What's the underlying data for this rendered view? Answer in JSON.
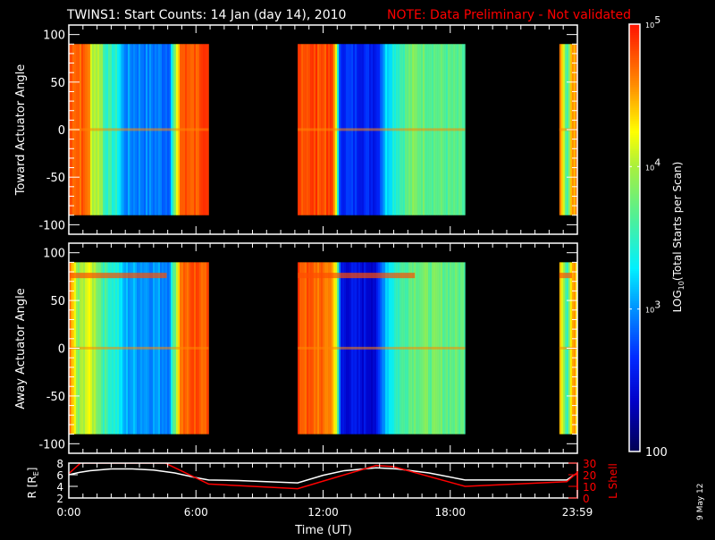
{
  "chart_data": {
    "type": "heatmap",
    "title": "TWINS1: Start Counts: 14 Jan (day  14), 2010",
    "note": "NOTE: Data Preliminary - Not validated",
    "date_stamp": "9 May 12",
    "colors": {
      "background": "#000000",
      "axis": "#ffffff",
      "note": "#ff0000",
      "lshell": "#ff0000",
      "radius": "#ffffff"
    },
    "xlabel": "Time (UT)",
    "x_ticks": [
      "0:00",
      "6:00",
      "12:00",
      "18:00",
      "23:59"
    ],
    "x_tick_hours": [
      0,
      6,
      12,
      18,
      24
    ],
    "xlim_hours": [
      0,
      24
    ],
    "colorbar": {
      "label": "LOG10(Total Starts per Scan)",
      "label_main": "LOG",
      "label_sub": "10",
      "label_rest": "(Total Starts per Scan)",
      "ticks": [
        "100",
        "10",
        "10",
        "10"
      ],
      "tick_exponents": [
        "",
        "3",
        "4",
        "5"
      ],
      "tick_log_values": [
        2,
        3,
        4,
        5
      ],
      "range_log": [
        2,
        5
      ]
    },
    "panels": [
      {
        "ylabel": "Toward Actuator Angle",
        "ylim": [
          -110,
          110
        ],
        "y_ticks": [
          "100",
          "50",
          "0",
          "-50",
          "-100"
        ],
        "y_tick_values": [
          100,
          50,
          0,
          -50,
          -100
        ],
        "angle_range": [
          -90,
          90
        ],
        "time_blocks_hours": [
          [
            0,
            6.6
          ],
          [
            10.8,
            18.7
          ],
          [
            23.15,
            24
          ]
        ],
        "log_counts_profile": [
          [
            0,
            4.8
          ],
          [
            0.9,
            4.7
          ],
          [
            1.0,
            4.1
          ],
          [
            1.5,
            4.0
          ],
          [
            1.6,
            3.6
          ],
          [
            2.3,
            3.4
          ],
          [
            2.5,
            3.0
          ],
          [
            4.7,
            2.9
          ],
          [
            4.9,
            3.6
          ],
          [
            5.1,
            4.2
          ],
          [
            5.2,
            4.75
          ],
          [
            6.6,
            4.8
          ],
          [
            10.8,
            4.85
          ],
          [
            12.4,
            4.8
          ],
          [
            12.6,
            4.2
          ],
          [
            12.7,
            2.7
          ],
          [
            14.5,
            2.6
          ],
          [
            14.9,
            3.2
          ],
          [
            15.4,
            3.5
          ],
          [
            16.2,
            3.8
          ],
          [
            18.7,
            3.6
          ],
          [
            23.15,
            4.6
          ],
          [
            23.5,
            3.4
          ],
          [
            23.7,
            4.6
          ],
          [
            24,
            4.5
          ]
        ],
        "zero_band_log": 4.6
      },
      {
        "ylabel": "Away Actuator Angle",
        "ylim": [
          -110,
          110
        ],
        "y_ticks": [
          "100",
          "50",
          "0",
          "-50",
          "-100"
        ],
        "y_tick_values": [
          100,
          50,
          0,
          -50,
          -100
        ],
        "angle_range": [
          -90,
          90
        ],
        "time_blocks_hours": [
          [
            0,
            6.6
          ],
          [
            10.8,
            18.7
          ],
          [
            23.15,
            24
          ]
        ],
        "log_counts_profile": [
          [
            0,
            4.7
          ],
          [
            0.4,
            3.8
          ],
          [
            0.8,
            4.2
          ],
          [
            1.2,
            4.0
          ],
          [
            1.6,
            3.6
          ],
          [
            2.3,
            3.4
          ],
          [
            2.5,
            3.1
          ],
          [
            4.7,
            3.0
          ],
          [
            4.9,
            3.6
          ],
          [
            5.1,
            4.2
          ],
          [
            5.2,
            4.7
          ],
          [
            6.6,
            4.8
          ],
          [
            10.8,
            4.8
          ],
          [
            12.4,
            4.6
          ],
          [
            12.6,
            4.0
          ],
          [
            12.8,
            2.5
          ],
          [
            14.5,
            2.45
          ],
          [
            14.9,
            3.2
          ],
          [
            15.4,
            3.5
          ],
          [
            16.2,
            3.8
          ],
          [
            18.7,
            3.7
          ],
          [
            23.15,
            4.5
          ],
          [
            23.5,
            3.5
          ],
          [
            23.7,
            4.5
          ],
          [
            24,
            4.4
          ]
        ],
        "high_band_angle": 75,
        "high_band_log": 4.8,
        "zero_band_log": 4.6
      }
    ],
    "ephemeris": {
      "left_ylabel": "R [R",
      "left_ylabel_sub": "E",
      "left_ylabel_end": "]",
      "right_ylabel": "L Shell",
      "left_ylim": [
        2,
        8
      ],
      "right_ylim": [
        0,
        30
      ],
      "left_ticks": [
        "8",
        "6",
        "4",
        "2"
      ],
      "left_tick_values": [
        8,
        6,
        4,
        2
      ],
      "right_ticks": [
        "30",
        "20",
        "10",
        "0"
      ],
      "right_tick_values": [
        30,
        20,
        10,
        0
      ],
      "series": [
        {
          "name": "R",
          "color": "#ffffff",
          "x": [
            0,
            0.5,
            1,
            2,
            3,
            4,
            5,
            6,
            6.6,
            8,
            10.8,
            12,
            13,
            14.5,
            15.5,
            17,
            18.7,
            20,
            23.5,
            24
          ],
          "y": [
            6.0,
            6.4,
            6.7,
            7.0,
            7.0,
            6.8,
            6.3,
            5.5,
            5.1,
            5.0,
            4.6,
            5.9,
            6.7,
            7.2,
            7.0,
            6.3,
            5.1,
            5.1,
            5.1,
            6.3
          ]
        },
        {
          "name": "L Shell",
          "color": "#ff0000",
          "x": [
            0,
            0.55,
            4.55,
            6.6,
            10.8,
            14.5,
            15.3,
            18.7,
            23.5,
            24
          ],
          "y": [
            21,
            30,
            30,
            12,
            8,
            28,
            27,
            10,
            14,
            22
          ]
        }
      ]
    }
  }
}
